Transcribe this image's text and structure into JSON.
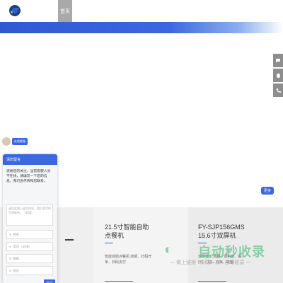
{
  "header": {
    "nav_home": "首页"
  },
  "float_tools": [
    {
      "icon": "chat-bubble-icon"
    },
    {
      "icon": "qq-icon"
    },
    {
      "icon": "phone-icon"
    }
  ],
  "agent": {
    "tag": "在线客服"
  },
  "chat": {
    "title": "请您留言",
    "message": "感谢您的关注，当前客服人员不在线，请填写一下您的信息，我们会尽快和您联系。",
    "textarea_placeholder": "请在此输入留言内容，我们会尽快与您联系。（必填）",
    "fields": [
      {
        "icon": "user-icon",
        "placeholder": "姓名"
      },
      {
        "icon": "phone-icon",
        "placeholder": "电话（必填）"
      },
      {
        "icon": "email-icon",
        "placeholder": "邮箱"
      },
      {
        "icon": "location-icon",
        "placeholder": "地址"
      }
    ],
    "submit_label": "提交"
  },
  "products": [
    {
      "title": "21.5寸智能自助点餐机",
      "desc": "智能自助点餐机,收银、扫码开单、扫码支付"
    },
    {
      "title": "FY-SJP156GMS 15.6寸双屏机",
      "desc": "双屏显示,商超、便利店、餐厅、门店、北美、收银"
    }
  ],
  "more_label": "更多",
  "watermark": {
    "brand": "自动秒收录",
    "sub": "一 做上链接 · 来访一次 · 自动收录 一"
  }
}
